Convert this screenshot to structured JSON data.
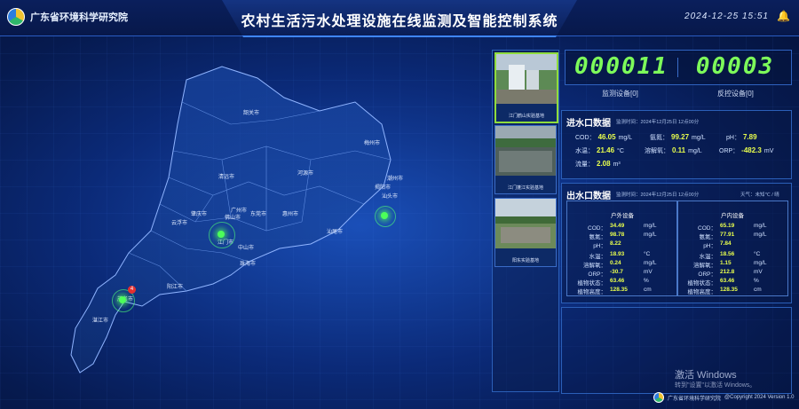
{
  "header": {
    "org": "广东省环境科学研究院",
    "title": "农村生活污水处理设施在线监测及智能控制系统",
    "datetime": "2024-12-25   15:51"
  },
  "map": {
    "cities": [
      {
        "name": "韶关市"
      },
      {
        "name": "梅州市"
      },
      {
        "name": "清远市"
      },
      {
        "name": "河源市"
      },
      {
        "name": "潮州市"
      },
      {
        "name": "揭阳市"
      },
      {
        "name": "汕头市"
      },
      {
        "name": "肇庆市"
      },
      {
        "name": "广州市"
      },
      {
        "name": "佛山市"
      },
      {
        "name": "东莞市"
      },
      {
        "name": "惠州市"
      },
      {
        "name": "汕尾市"
      },
      {
        "name": "云浮市"
      },
      {
        "name": "江门市"
      },
      {
        "name": "中山市"
      },
      {
        "name": "珠海市"
      },
      {
        "name": "阳江市"
      },
      {
        "name": "茂名市"
      },
      {
        "name": "湛江市"
      }
    ],
    "badge_count": "4"
  },
  "thumbnails": [
    {
      "caption": "江门鹤山实验基地"
    },
    {
      "caption": "江门蓬江实验基地"
    },
    {
      "caption": "阳东实验基地"
    }
  ],
  "counters": {
    "monitor_value": "000011",
    "monitor_label": "监测设备[0]",
    "control_value": "00003",
    "control_label": "反控设备[0]"
  },
  "inlet": {
    "title": "进水口数据",
    "meta": "监测时间：2024年12月25日 12点00分",
    "rows": [
      {
        "label": "COD：",
        "value": "46.05",
        "unit": "mg/L"
      },
      {
        "label": "氨氮：",
        "value": "99.27",
        "unit": "mg/L"
      },
      {
        "label": "pH：",
        "value": "7.89",
        "unit": ""
      },
      {
        "label": "水温：",
        "value": "21.46",
        "unit": "°C"
      },
      {
        "label": "溶解氧：",
        "value": "0.11",
        "unit": "mg/L"
      },
      {
        "label": "ORP：",
        "value": "-482.3",
        "unit": "mV"
      },
      {
        "label": "流量：",
        "value": "2.08",
        "unit": "m³"
      }
    ]
  },
  "outlet": {
    "title": "出水口数据",
    "meta": "监测时间：2024年12月25日 12点00分",
    "weather": "天气：未知℃ / 晴",
    "devices": [
      {
        "name": "户外设备",
        "rows": [
          {
            "label": "COD：",
            "value": "34.49",
            "unit": "mg/L"
          },
          {
            "label": "氨氮：",
            "value": "98.78",
            "unit": "mg/L"
          },
          {
            "label": "pH：",
            "value": "8.22",
            "unit": ""
          },
          {
            "label": "水温：",
            "value": "18.93",
            "unit": "°C"
          },
          {
            "label": "溶解氧：",
            "value": "0.24",
            "unit": "mg/L"
          },
          {
            "label": "ORP：",
            "value": "-30.7",
            "unit": "mV"
          },
          {
            "label": "植物状态：",
            "value": "63.46",
            "unit": "%"
          },
          {
            "label": "植物高度：",
            "value": "128.35",
            "unit": "cm"
          }
        ]
      },
      {
        "name": "户内设备",
        "rows": [
          {
            "label": "COD：",
            "value": "65.19",
            "unit": "mg/L"
          },
          {
            "label": "氨氮：",
            "value": "77.91",
            "unit": "mg/L"
          },
          {
            "label": "pH：",
            "value": "7.84",
            "unit": ""
          },
          {
            "label": "水温：",
            "value": "18.56",
            "unit": "°C"
          },
          {
            "label": "溶解氧：",
            "value": "1.15",
            "unit": "mg/L"
          },
          {
            "label": "ORP：",
            "value": "212.8",
            "unit": "mV"
          },
          {
            "label": "植物状态：",
            "value": "63.46",
            "unit": "%"
          },
          {
            "label": "植物高度：",
            "value": "128.35",
            "unit": "cm"
          }
        ]
      }
    ]
  },
  "watermark": {
    "line1": "激活 Windows",
    "line2": "转到\"设置\"以激活 Windows。"
  },
  "footer": {
    "org": "广东省环境科学研究院",
    "copyright": "@Copyright 2024 Version 1.0"
  }
}
